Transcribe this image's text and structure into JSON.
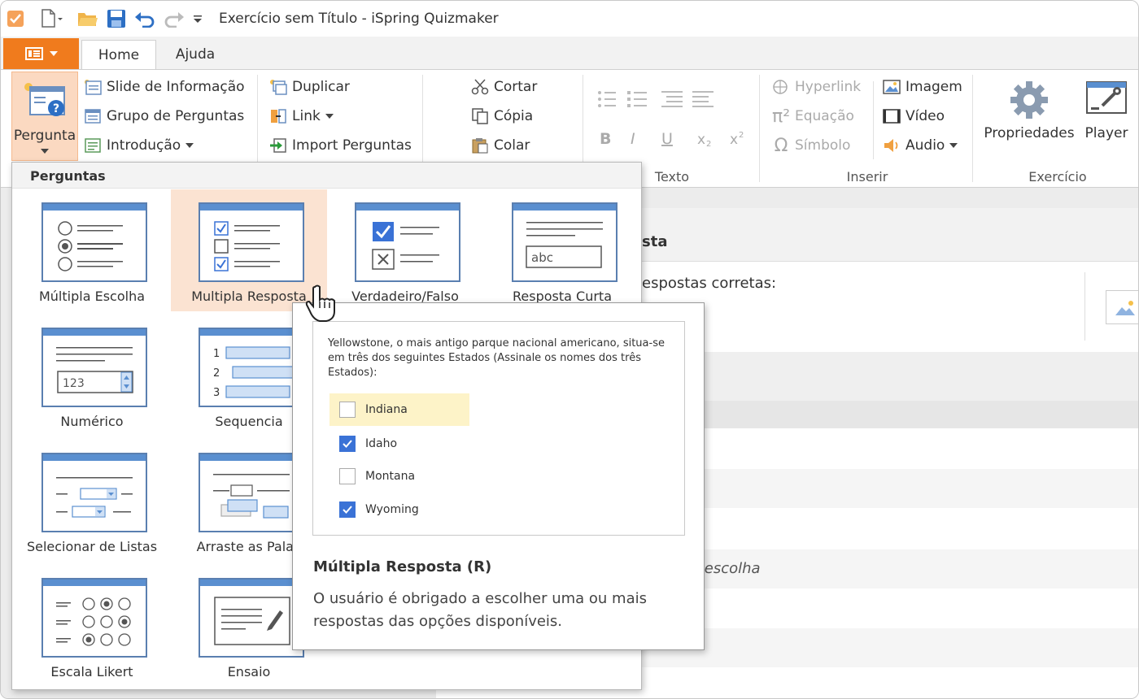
{
  "window": {
    "title": "Exercício sem Título - iSpring Quizmaker"
  },
  "tabs": [
    {
      "label": "Home",
      "active": true
    },
    {
      "label": "Ajuda",
      "active": false
    }
  ],
  "ribbon": {
    "pergunta": {
      "label": "Pergunta"
    },
    "insert_slide": {
      "slide_info": "Slide de Informação",
      "question_group": "Grupo de Perguntas",
      "intro": "Introdução"
    },
    "edit": {
      "duplicate": "Duplicar",
      "link": "Link",
      "import": "Import Perguntas"
    },
    "clipboard": {
      "cut": "Cortar",
      "copy": "Cópia",
      "paste": "Colar"
    },
    "text_group_label": "Texto",
    "insert": {
      "hyperlink": "Hyperlink",
      "equation": "Equação",
      "symbol": "Símbolo",
      "image": "Imagem",
      "video": "Vídeo",
      "audio": "Audio",
      "group_label": "Inserir"
    },
    "exercise": {
      "properties": "Propriedades",
      "player": "Player",
      "group_label": "Exercício"
    }
  },
  "background": {
    "heading_fragment": "sta",
    "correct_answers_fragment": "espostas corretas:",
    "choice_fragment": "a escolha"
  },
  "dropdown": {
    "header": "Perguntas",
    "items": [
      {
        "label": "Múltipla Escolha"
      },
      {
        "label": "Multipla Resposta"
      },
      {
        "label": "Verdadeiro/Falso"
      },
      {
        "label": "Resposta Curta"
      },
      {
        "label": "Numérico"
      },
      {
        "label": "Sequencia"
      },
      {
        "label": "Selecionar de Listas"
      },
      {
        "label": "Arraste as Palav"
      },
      {
        "label": "Escala Likert"
      },
      {
        "label": "Ensaio"
      }
    ],
    "short_answer_sample": "abc",
    "numeric_sample": "123",
    "sequence_numbers": [
      "1",
      "2",
      "3"
    ]
  },
  "tooltip": {
    "question": "Yellowstone, o mais antigo parque nacional americano, situa-se em três dos seguintes Estados (Assinale os nomes dos três Estados):",
    "options": [
      {
        "label": "Indiana",
        "checked": false
      },
      {
        "label": "Idaho",
        "checked": true
      },
      {
        "label": "Montana",
        "checked": false
      },
      {
        "label": "Wyoming",
        "checked": true
      }
    ],
    "title": "Múltipla Resposta (R)",
    "description": "O usuário é obrigado a escolher uma ou mais respostas das opções disponíveis."
  },
  "colors": {
    "accent_orange": "#f07b1d",
    "selection_peach": "#fbe3d2",
    "icon_blue": "#5a8fd0",
    "checkbox_blue": "#3a72d6"
  }
}
